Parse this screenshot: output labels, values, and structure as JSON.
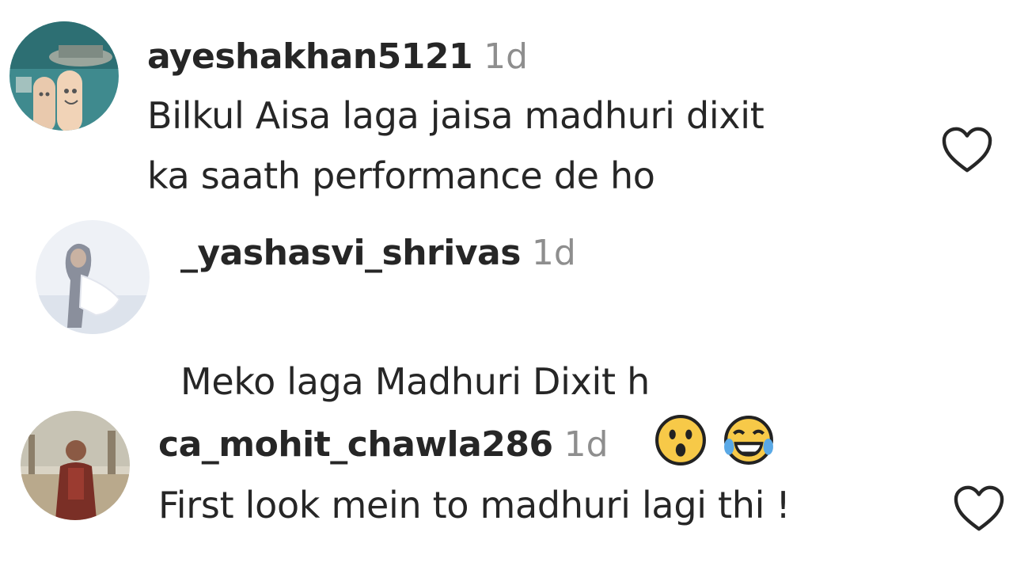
{
  "comments": [
    {
      "username": "ayeshakhan5121",
      "time": "1d",
      "text": "Bilkul Aisa laga jaisa madhuri dixit\nka saath performance de ho"
    },
    {
      "username": "_yashasvi_shrivas",
      "time": "1d",
      "text": "Meko laga Madhuri Dixit h",
      "emojis": [
        "hushed-face-emoji",
        "tears-of-joy-emoji"
      ]
    },
    {
      "username": "ca_mohit_chawla286",
      "time": "1d",
      "text": "First look mein to madhuri lagi thi !"
    }
  ],
  "colors": {
    "text": "#262626",
    "secondary": "#8e8e8e",
    "heart_stroke": "#262626",
    "emoji_yellow": "#f7c948"
  }
}
